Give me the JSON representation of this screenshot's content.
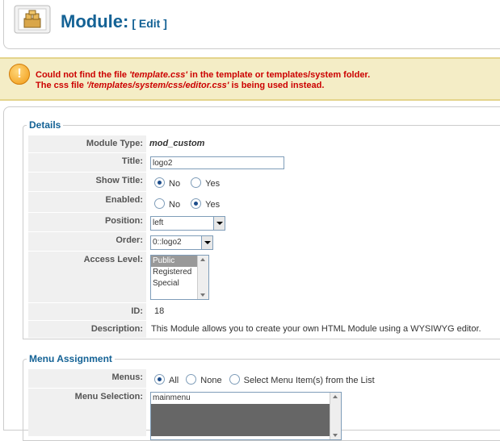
{
  "header": {
    "title": "Module:",
    "subtitle": "[ Edit ]",
    "icon": "module-icon"
  },
  "notice": {
    "line1_prefix": "Could not find the file ",
    "line1_file": "'template.css'",
    "line1_suffix": " in the template or templates/system folder.",
    "line2_prefix": "The css file ",
    "line2_file": "'/templates/system/css/editor.css'",
    "line2_suffix": " is being used instead.",
    "icon": "warning-icon"
  },
  "details": {
    "legend": "Details",
    "module_type_label": "Module Type:",
    "module_type_value": "mod_custom",
    "title_label": "Title:",
    "title_value": "logo2",
    "show_title_label": "Show Title:",
    "show_title_options": [
      "No",
      "Yes"
    ],
    "show_title_selected": "No",
    "enabled_label": "Enabled:",
    "enabled_options": [
      "No",
      "Yes"
    ],
    "enabled_selected": "Yes",
    "position_label": "Position:",
    "position_value": "left",
    "order_label": "Order:",
    "order_value": "0::logo2",
    "access_label": "Access Level:",
    "access_options": [
      "Public",
      "Registered",
      "Special"
    ],
    "access_selected": "Public",
    "id_label": "ID:",
    "id_value": "18",
    "description_label": "Description:",
    "description_value": "This Module allows you to create your own HTML Module using a WYSIWYG editor."
  },
  "menu_assignment": {
    "legend": "Menu Assignment",
    "menus_label": "Menus:",
    "menus_options": [
      "All",
      "None",
      "Select Menu Item(s) from the List"
    ],
    "menus_selected": "All",
    "menu_selection_label": "Menu Selection:",
    "menu_selection_items": [
      "mainmenu"
    ]
  }
}
